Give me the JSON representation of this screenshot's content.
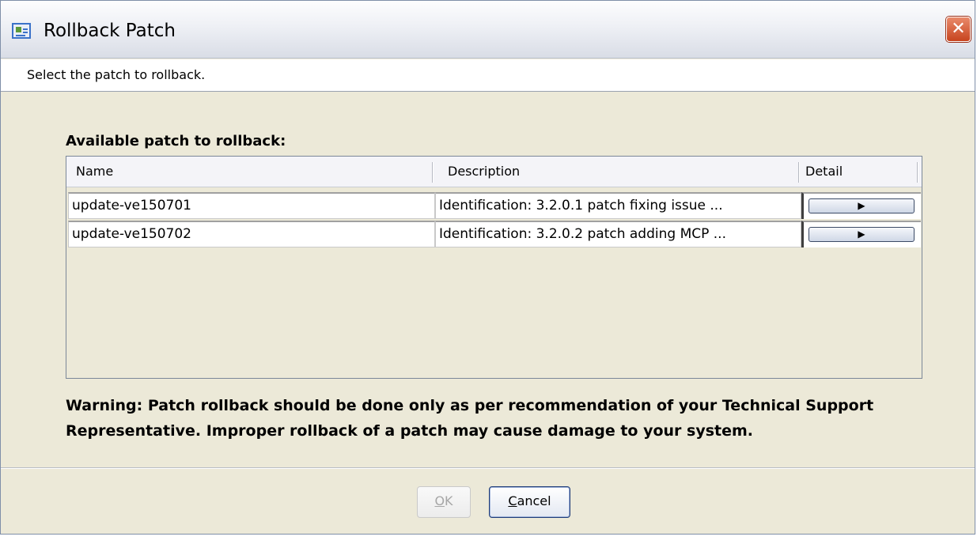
{
  "window": {
    "title": "Rollback Patch",
    "close_glyph": "✕",
    "icon": "window-app-icon"
  },
  "instruction": "Select the patch to rollback.",
  "table": {
    "label": "Available patch to rollback:",
    "columns": [
      "Name",
      "Description",
      "Detail"
    ],
    "rows": [
      {
        "name": "update-ve150701",
        "description": "Identification: 3.2.0.1 patch fixing issue ...",
        "detail_glyph": "▶"
      },
      {
        "name": "update-ve150702",
        "description": "Identification: 3.2.0.2 patch adding MCP ...",
        "detail_glyph": "▶"
      }
    ]
  },
  "warning": "Warning: Patch rollback should be done only as per recommendation of your Technical Support Representative. Improper rollback of a patch may cause damage to your system.",
  "buttons": {
    "ok_mnemonic": "O",
    "ok_rest": "K",
    "ok_enabled": false,
    "cancel_mnemonic": "C",
    "cancel_rest": "ancel"
  },
  "colors": {
    "dialog_bg": "#ece9d8",
    "close_button": "#c7441e",
    "border": "#7b8798"
  }
}
